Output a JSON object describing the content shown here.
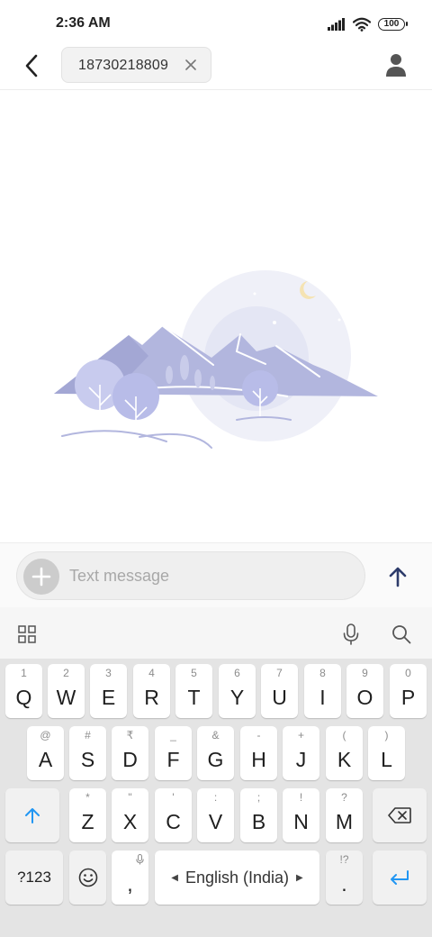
{
  "status_bar": {
    "time": "2:36 AM",
    "battery_level": "100"
  },
  "header": {
    "recipient": "18730218809"
  },
  "composer": {
    "placeholder": "Text message"
  },
  "keyboard": {
    "rows": [
      [
        {
          "key": "Q",
          "hint": "1"
        },
        {
          "key": "W",
          "hint": "2"
        },
        {
          "key": "E",
          "hint": "3"
        },
        {
          "key": "R",
          "hint": "4"
        },
        {
          "key": "T",
          "hint": "5"
        },
        {
          "key": "Y",
          "hint": "6"
        },
        {
          "key": "U",
          "hint": "7"
        },
        {
          "key": "I",
          "hint": "8"
        },
        {
          "key": "O",
          "hint": "9"
        },
        {
          "key": "P",
          "hint": "0"
        }
      ],
      [
        {
          "key": "A",
          "hint": "@"
        },
        {
          "key": "S",
          "hint": "#"
        },
        {
          "key": "D",
          "hint": "₹"
        },
        {
          "key": "F",
          "hint": "_"
        },
        {
          "key": "G",
          "hint": "&"
        },
        {
          "key": "H",
          "hint": "-"
        },
        {
          "key": "J",
          "hint": "+"
        },
        {
          "key": "K",
          "hint": "("
        },
        {
          "key": "L",
          "hint": ")"
        }
      ],
      [
        {
          "key": "Z",
          "hint": "*"
        },
        {
          "key": "X",
          "hint": "\""
        },
        {
          "key": "C",
          "hint": "'"
        },
        {
          "key": "V",
          "hint": ":"
        },
        {
          "key": "B",
          "hint": ";"
        },
        {
          "key": "N",
          "hint": "!"
        },
        {
          "key": "M",
          "hint": "?"
        }
      ]
    ],
    "symbols_label": "?123",
    "comma": ",",
    "space_label": "English (India)",
    "period": ".",
    "period_hint": "!?",
    "accent_color": "#2196f3"
  }
}
